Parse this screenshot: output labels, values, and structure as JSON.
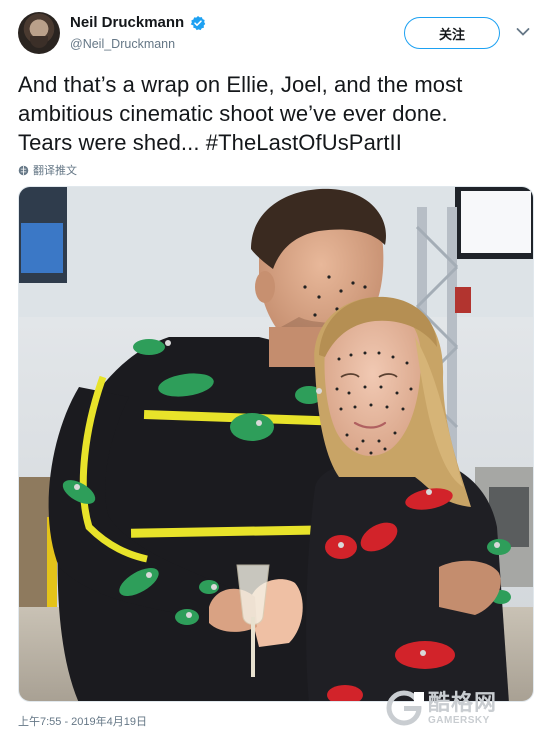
{
  "author": {
    "display_name": "Neil Druckmann",
    "handle": "@Neil_Druckmann",
    "verified": true
  },
  "follow_button_label": "关注",
  "tweet_text": {
    "line1": "And that’s a wrap on Ellie, Joel, and the most",
    "line2": "ambitious cinematic shoot we’ve ever done.",
    "line3_text": "Tears were shed... ",
    "hashtag": "#TheLastOfUsPartII"
  },
  "translate_label": "翻译推文",
  "timestamp": "上午7:55 - 2019年4月19日",
  "watermark": {
    "cn": "酷格网",
    "en": "GAMERSKY"
  },
  "icons": {
    "verified": "verified-badge-icon",
    "menu": "chevron-down-icon",
    "translate": "globe-icon"
  },
  "colors": {
    "accent": "#1da1f2",
    "text": "#14171a",
    "secondary": "#657786",
    "suit": "#1b1b1f",
    "marker_green": "#2e9e5a",
    "marker_red": "#d2232a",
    "tape_yellow": "#e8e32a"
  }
}
